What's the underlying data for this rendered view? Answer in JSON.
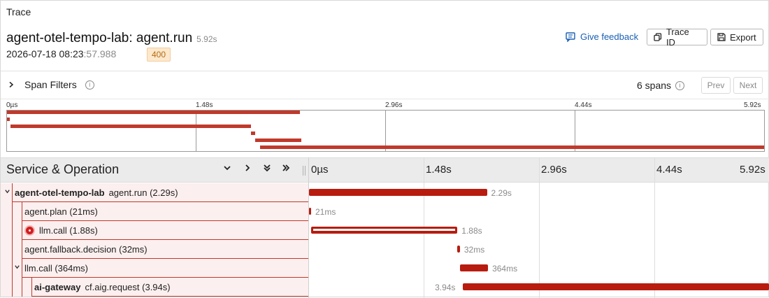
{
  "header": {
    "section": "Trace",
    "title": "agent-otel-tempo-lab: agent.run",
    "duration": "5.92s",
    "timestamp_main": "2026-07-18 08:23",
    "timestamp_ms": ":57.988",
    "status_badge": "400",
    "feedback_label": "Give feedback",
    "trace_id_label": "Trace ID",
    "export_label": "Export"
  },
  "filters": {
    "label": "Span Filters",
    "span_count": "6 spans",
    "prev_label": "Prev",
    "next_label": "Next"
  },
  "minimap": {
    "ticks": [
      "0µs",
      "1.48s",
      "2.96s",
      "4.44s",
      "5.92s"
    ]
  },
  "timeline": {
    "column_title": "Service & Operation",
    "ticks": [
      "0µs",
      "1.48s",
      "2.96s",
      "4.44s",
      "5.92s"
    ],
    "total_seconds": 5.92,
    "spans": [
      {
        "service": "agent-otel-tempo-lab",
        "operation": "agent.run (2.29s)",
        "depth": 0,
        "expanded": true,
        "error": false,
        "start": 0.0,
        "duration": 2.29,
        "label": "2.29s"
      },
      {
        "service": "",
        "operation": "agent.plan (21ms)",
        "depth": 1,
        "error": false,
        "start": 0.0,
        "duration": 0.021,
        "label": "21ms"
      },
      {
        "service": "",
        "operation": "llm.call (1.88s)",
        "depth": 1,
        "error": true,
        "start": 0.03,
        "duration": 1.88,
        "label": "1.88s"
      },
      {
        "service": "",
        "operation": "agent.fallback.decision (32ms)",
        "depth": 1,
        "error": false,
        "start": 1.91,
        "duration": 0.032,
        "label": "32ms"
      },
      {
        "service": "",
        "operation": "llm.call (364ms)",
        "depth": 1,
        "expanded": true,
        "error": false,
        "start": 1.94,
        "duration": 0.364,
        "label": "364ms"
      },
      {
        "service": "ai-gateway",
        "operation": "cf.aig.request (3.94s)",
        "depth": 2,
        "error": false,
        "start": 1.98,
        "duration": 3.94,
        "label": "3.94s"
      }
    ]
  },
  "colors": {
    "span": "#b71c0f",
    "link": "#1a5fb4",
    "badge_bg": "#fde8cc"
  }
}
